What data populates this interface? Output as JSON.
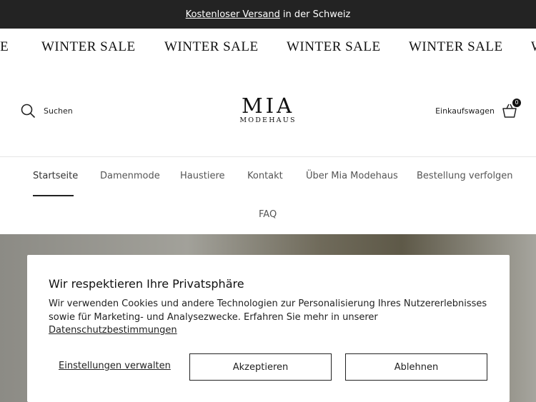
{
  "announcement": {
    "link_text": "Kostenloser Versand",
    "rest_text": "in der Schweiz"
  },
  "marquee": {
    "items": [
      "LE",
      "WINTER SALE",
      "WINTER SALE",
      "WINTER SALE",
      "WINTER SALE",
      "W"
    ]
  },
  "header": {
    "search_label": "Suchen",
    "search_icon": "search-icon",
    "logo_main": "MIA",
    "logo_sub": "MODEHAUS",
    "cart_label": "Einkaufswagen",
    "cart_icon": "shopping-bag-icon",
    "cart_count": "0"
  },
  "nav": {
    "items": [
      {
        "label": "Startseite",
        "active": true
      },
      {
        "label": "Damenmode"
      },
      {
        "label": "Haustiere"
      },
      {
        "label": "Kontakt"
      },
      {
        "label": "Über Mia Modehaus"
      },
      {
        "label": "Bestellung verfolgen"
      },
      {
        "label": "FAQ"
      }
    ]
  },
  "cookie": {
    "title": "Wir respektieren Ihre Privatsphäre",
    "body_text": "Wir verwenden Cookies und andere Technologien zur Personalisierung Ihres Nutzererlebnisses sowie für Marketing- und Analysezwecke. Erfahren Sie mehr in unserer",
    "privacy_link": "Datenschutzbestimmungen",
    "manage_label": "Einstellungen verwalten",
    "accept_label": "Akzeptieren",
    "decline_label": "Ablehnen"
  },
  "colors": {
    "announcement_bg": "#232323",
    "text": "#222222",
    "border": "#222222"
  }
}
